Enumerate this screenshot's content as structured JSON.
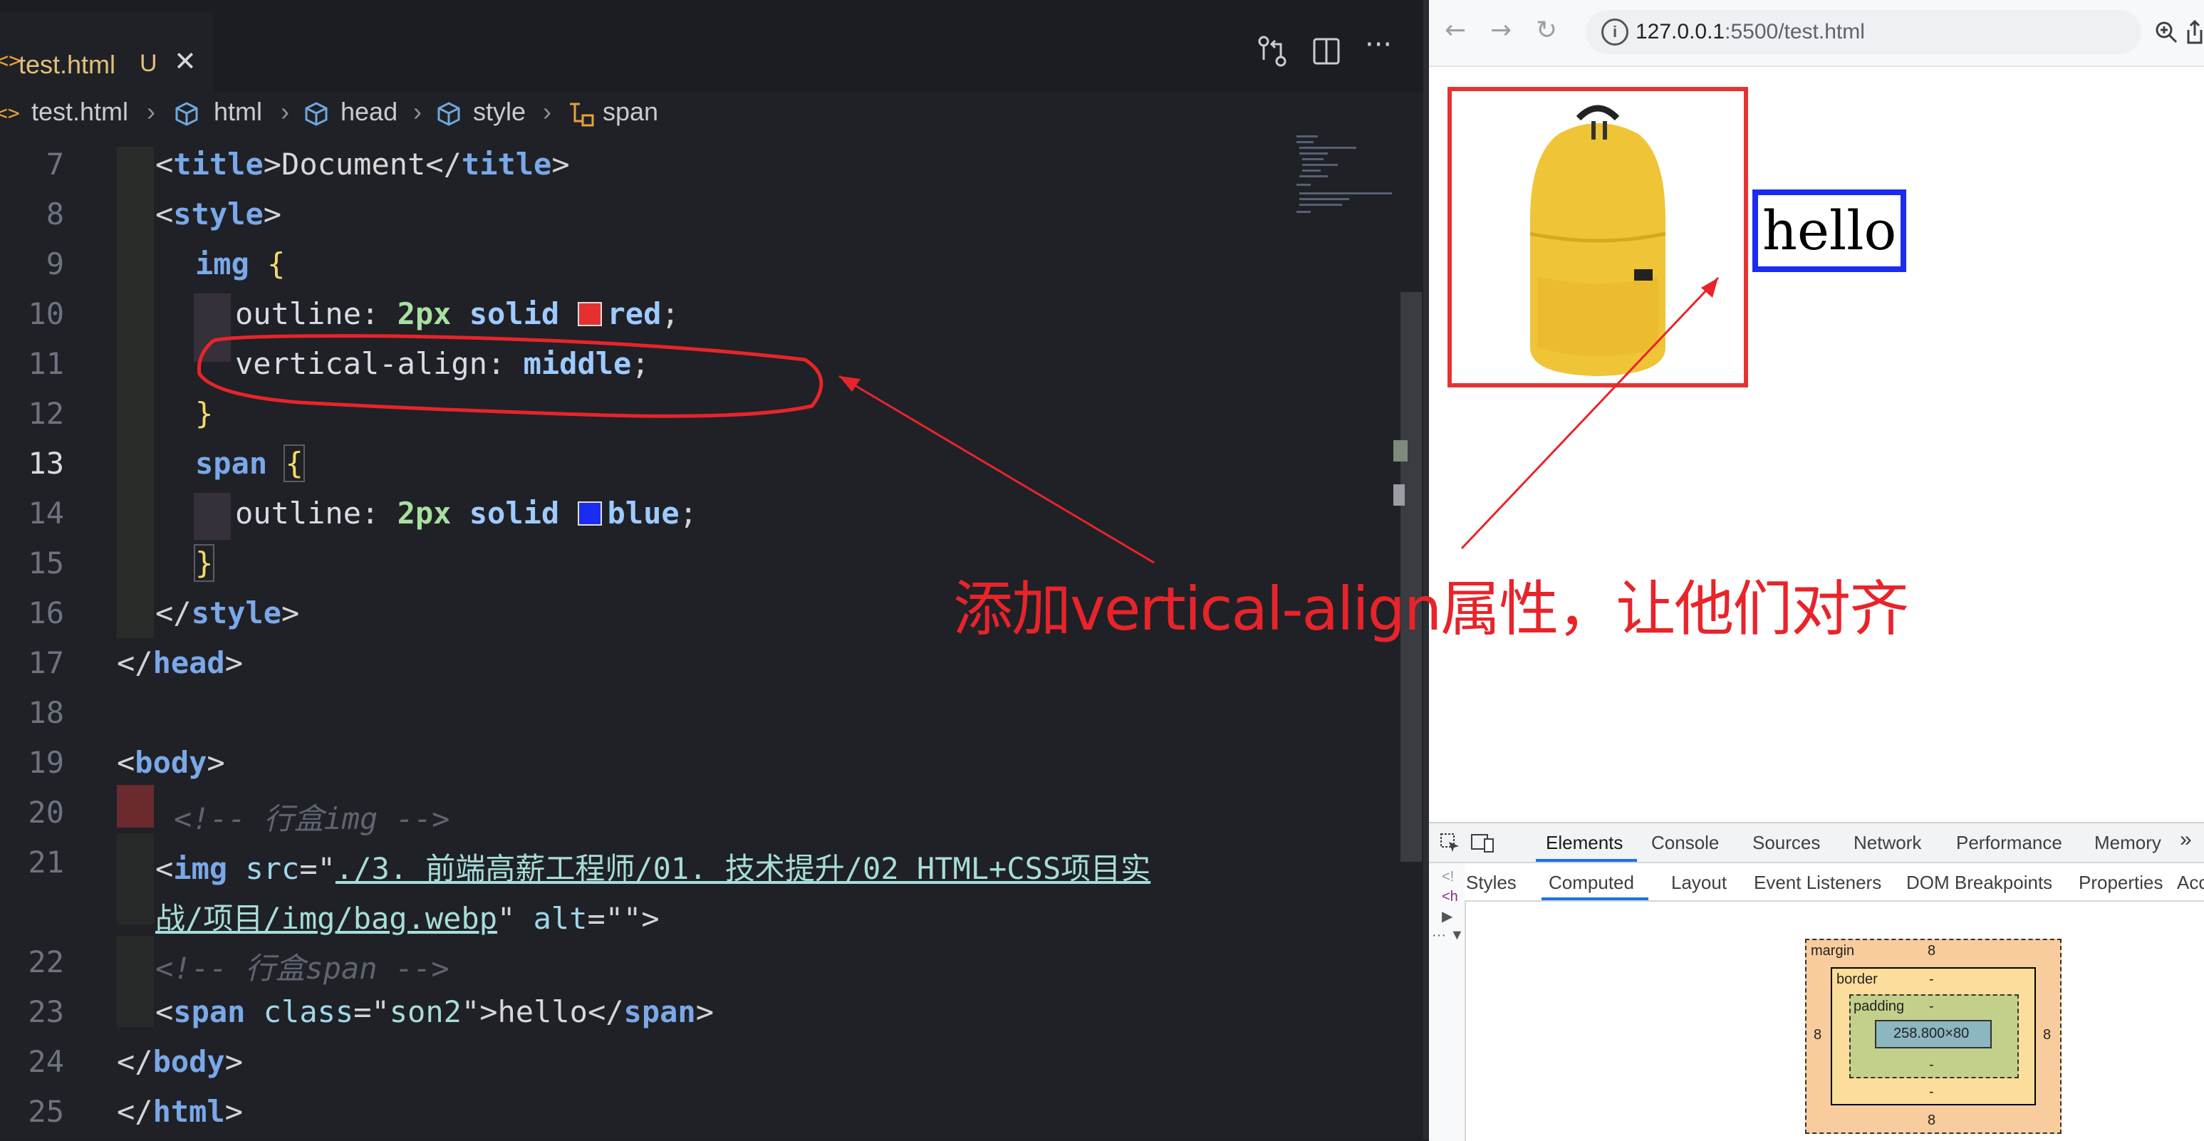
{
  "editor": {
    "tab": {
      "icon": "html-file-icon",
      "label": "test.html",
      "status": "U"
    },
    "breadcrumb": [
      "test.html",
      "html",
      "head",
      "style",
      "span"
    ],
    "lines": {
      "l7": {
        "num": "7",
        "a": "<",
        "tag": "title",
        "b": ">",
        "text": "Document",
        "c": "</",
        "tag2": "title",
        "d": ">"
      },
      "l8": {
        "num": "8",
        "a": "<",
        "tag": "style",
        "b": ">"
      },
      "l9": {
        "num": "9",
        "sel": "img",
        "brace": "{"
      },
      "l10": {
        "num": "10",
        "prop": "outline",
        "colon": ":",
        "n": "2px",
        "v": "solid",
        "color": "red",
        "semi": ";"
      },
      "l11": {
        "num": "11",
        "prop": "vertical-align",
        "colon": ":",
        "v": "middle",
        "semi": ";"
      },
      "l12": {
        "num": "12",
        "brace": "}"
      },
      "l13": {
        "num": "13",
        "sel": "span",
        "brace": "{"
      },
      "l14": {
        "num": "14",
        "prop": "outline",
        "colon": ":",
        "n": "2px",
        "v": "solid",
        "color": "blue",
        "semi": ";"
      },
      "l15": {
        "num": "15",
        "brace": "}"
      },
      "l16": {
        "num": "16",
        "a": "</",
        "tag": "style",
        "b": ">"
      },
      "l17": {
        "num": "17",
        "a": "</",
        "tag": "head",
        "b": ">"
      },
      "l18": {
        "num": "18"
      },
      "l19": {
        "num": "19",
        "a": "<",
        "tag": "body",
        "b": ">"
      },
      "l20": {
        "num": "20",
        "comment": "<!-- 行盒img -->"
      },
      "l21": {
        "num": "21",
        "a": "<",
        "tag": "img",
        "attr": "src",
        "eq": "=\"",
        "src1": "./3. 前端高薪工程师/01. 技术提升/02 HTML+CSS项目实",
        "src2": "战/项目/img/bag.webp",
        "q": "\"",
        "alt": "alt",
        "alteq": "=\"\"",
        "b": ">"
      },
      "l22": {
        "num": "22",
        "comment": "<!-- 行盒span -->"
      },
      "l23": {
        "num": "23",
        "a": "<",
        "tag": "span",
        "attr": "class",
        "eq": "=\"",
        "cls": "son2",
        "q": "\"",
        "b": ">",
        "text": "hello",
        "c": "</",
        "tag2": "span",
        "d": ">"
      },
      "l24": {
        "num": "24",
        "a": "</",
        "tag": "body",
        "b": ">"
      },
      "l25": {
        "num": "25",
        "a": "</",
        "tag": "html",
        "b": ">"
      }
    },
    "colors": {
      "red_swatch": "#e53030",
      "blue_swatch": "#1a2cf0"
    }
  },
  "annotation": {
    "text": "添加vertical-align属性，让他们对齐",
    "color": "#e8242a"
  },
  "browser": {
    "url_host": "127.0.0.1",
    "url_path": ":5500/test.html",
    "hello": "hello",
    "devtools": {
      "tabs": [
        "Elements",
        "Console",
        "Sources",
        "Network",
        "Performance",
        "Memory"
      ],
      "subtabs": [
        "Styles",
        "Computed",
        "Layout",
        "Event Listeners",
        "DOM Breakpoints",
        "Properties",
        "Acce"
      ],
      "box_model": {
        "margin_label": "margin",
        "margin_top": "8",
        "margin_bottom": "8",
        "margin_left": "8",
        "margin_right": "8",
        "border_label": "border",
        "border_top": "-",
        "border_bottom": "-",
        "padding_label": "padding",
        "padding_top": "-",
        "padding_bottom": "-",
        "content": "258.800×80"
      }
    }
  }
}
